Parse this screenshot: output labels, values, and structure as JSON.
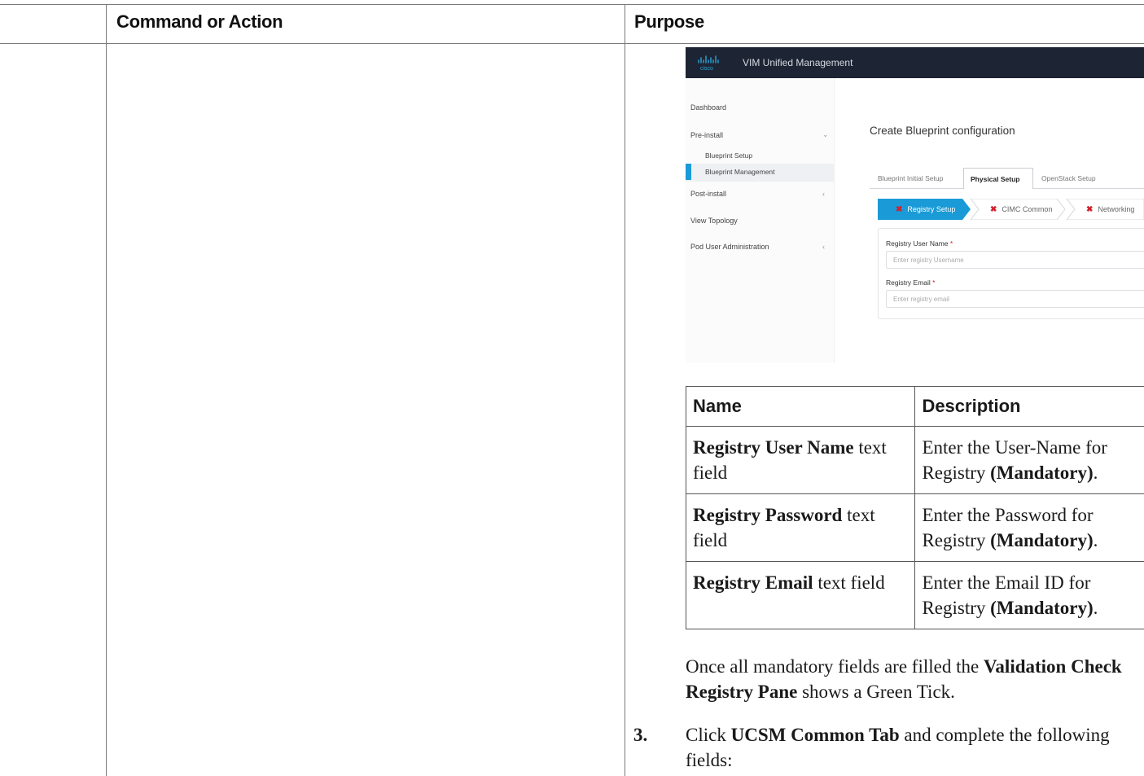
{
  "header": {
    "col_command": "Command or Action",
    "col_purpose": "Purpose"
  },
  "screenshot": {
    "app_title": "VIM Unified Management",
    "nav": {
      "dashboard": "Dashboard",
      "pre_install": "Pre-install",
      "blueprint_setup": "Blueprint Setup",
      "blueprint_management": "Blueprint Management",
      "post_install": "Post-install",
      "view_topology": "View Topology",
      "pod_user_admin": "Pod User Administration"
    },
    "page_title": "Create Blueprint configuration",
    "tabs": [
      "Blueprint Initial Setup",
      "Physical Setup",
      "OpenStack Setup"
    ],
    "steps": [
      "Registry Setup",
      "CIMC Common",
      "Networking"
    ],
    "form": {
      "user_label": "Registry User Name",
      "user_placeholder": "Enter registry Username",
      "email_label": "Registry Email",
      "email_placeholder": "Enter registry email",
      "required_mark": "*"
    }
  },
  "table": {
    "headers": [
      "Name",
      "Description"
    ],
    "rows": [
      {
        "name_bold": "Registry User Name",
        "name_rest": " text field",
        "desc": "Enter the User-Name for Registry ",
        "desc_bold": "(Mandatory)",
        "desc_end": "."
      },
      {
        "name_bold": "Registry Password",
        "name_rest": " text field",
        "desc": "Enter the Password for Registry ",
        "desc_bold": "(Mandatory)",
        "desc_end": "."
      },
      {
        "name_bold": "Registry Email",
        "name_rest": " text field",
        "desc": "Enter the Email ID for Registry ",
        "desc_bold": "(Mandatory)",
        "desc_end": "."
      }
    ]
  },
  "note": {
    "pre": "Once all mandatory fields are filled the ",
    "bold": "Validation Check Registry Pane",
    "post": " shows a Green Tick."
  },
  "step3": {
    "number": "3.",
    "pre": "Click ",
    "bold": "UCSM Common Tab",
    "post": " and complete the following fields:"
  }
}
